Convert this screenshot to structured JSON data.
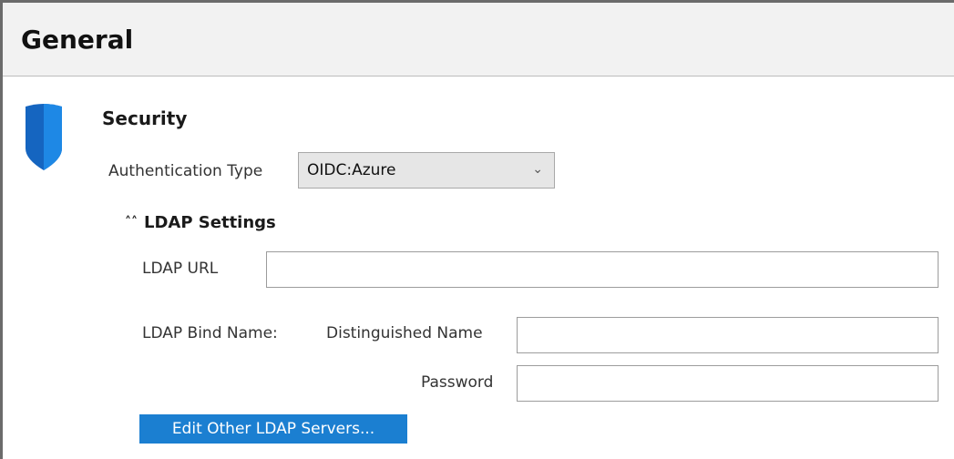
{
  "header": {
    "title": "General"
  },
  "security": {
    "title": "Security",
    "auth_type_label": "Authentication Type",
    "auth_type_value": "OIDC:Azure"
  },
  "ldap": {
    "toggle_icon": "double-chevron-up-icon",
    "title": "LDAP Settings",
    "url_label": "LDAP URL",
    "url_value": "",
    "bind_name_label": "LDAP Bind Name:",
    "dn_label": "Distinguished Name",
    "dn_value": "",
    "password_label": "Password",
    "password_value": "",
    "edit_button_label": "Edit Other LDAP Servers..."
  },
  "colors": {
    "accent": "#1b7fd1",
    "shield": "#1565c0"
  }
}
